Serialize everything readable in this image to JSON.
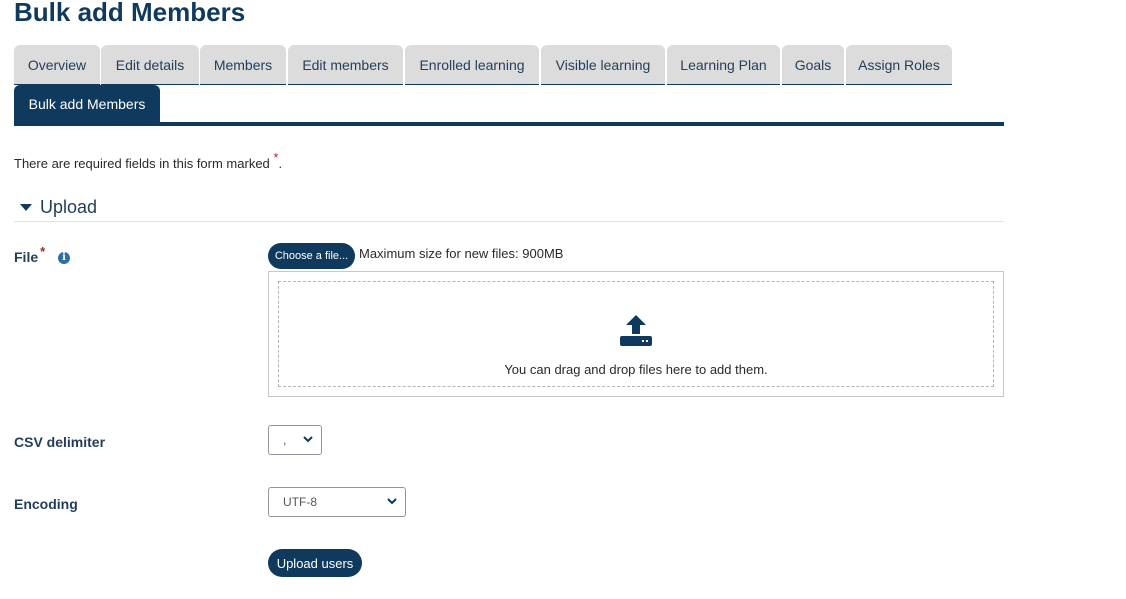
{
  "page": {
    "title": "Bulk add Members"
  },
  "tabs": [
    {
      "label": "Overview"
    },
    {
      "label": "Edit details"
    },
    {
      "label": "Members"
    },
    {
      "label": "Edit members"
    },
    {
      "label": "Enrolled learning"
    },
    {
      "label": "Visible learning"
    },
    {
      "label": "Learning Plan"
    },
    {
      "label": "Goals"
    },
    {
      "label": "Assign Roles"
    },
    {
      "label": "Bulk add Members",
      "active": true
    }
  ],
  "form": {
    "required_note": "There are required fields in this form marked",
    "required_star": "*",
    "required_note_end": ".",
    "section_title": "Upload",
    "file": {
      "label": "File",
      "required_star": "*",
      "info_icon": "i",
      "choose_button": "Choose a file...",
      "max_size": "Maximum size for new files: 900MB",
      "drop_text": "You can drag and drop files here to add them."
    },
    "csv_delimiter": {
      "label": "CSV delimiter",
      "value": ","
    },
    "encoding": {
      "label": "Encoding",
      "value": "UTF-8"
    },
    "submit_label": "Upload users"
  },
  "colors": {
    "primary": "#0f3a5e",
    "tab_background": "#dcdcdc",
    "required": "#a4262c",
    "info": "#2c6ea8"
  },
  "icons": {
    "section_toggle": "caret-down-icon",
    "info": "info-circle-icon",
    "dropzone": "upload-icon",
    "select": "chevron-down-icon"
  }
}
